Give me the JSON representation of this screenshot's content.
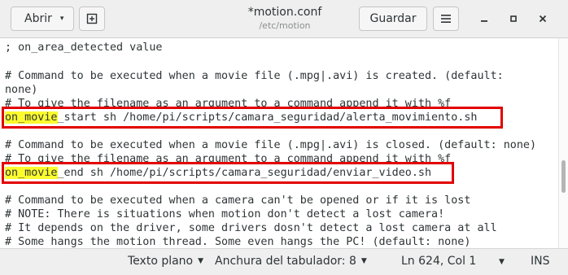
{
  "header": {
    "open_label": "Abrir",
    "save_label": "Guardar",
    "title": "*motion.conf",
    "subtitle": "/etc/motion",
    "icons": {
      "open_dropdown": "▾",
      "new_tab": "⊞",
      "menu": "☰",
      "minimize": "‒",
      "maximize": "▫",
      "close": "✕"
    }
  },
  "editor": {
    "lines": [
      "; on_area_detected value",
      "",
      "# Command to be executed when a movie file (.mpg|.avi) is created. (default:",
      "none)",
      "# To give the filename as an argument to a command append it with %f",
      "_start sh /home/pi/scripts/camara_seguridad/alerta_movimiento.sh",
      "",
      "# Command to be executed when a movie file (.mpg|.avi) is closed. (default: none)",
      "# To give the filename as an argument to a command append it with %f",
      "_end sh /home/pi/scripts/camara_seguridad/enviar_video.sh",
      "",
      "# Command to be executed when a camera can't be opened or if it is lost",
      "# NOTE: There is situations when motion don't detect a lost camera!",
      "# It depends on the driver, some drivers dosn't detect a lost camera at all",
      "# Some hangs the motion thread. Some even hangs the PC! (default: none)"
    ],
    "highlight_word": "on_movie",
    "highlight_color": "#fcfc2d",
    "box_color": "#e20000"
  },
  "statusbar": {
    "language": "Texto plano",
    "tab_width": "Anchura del tabulador: 8",
    "position": "Ln 624, Col 1",
    "mode": "INS"
  }
}
